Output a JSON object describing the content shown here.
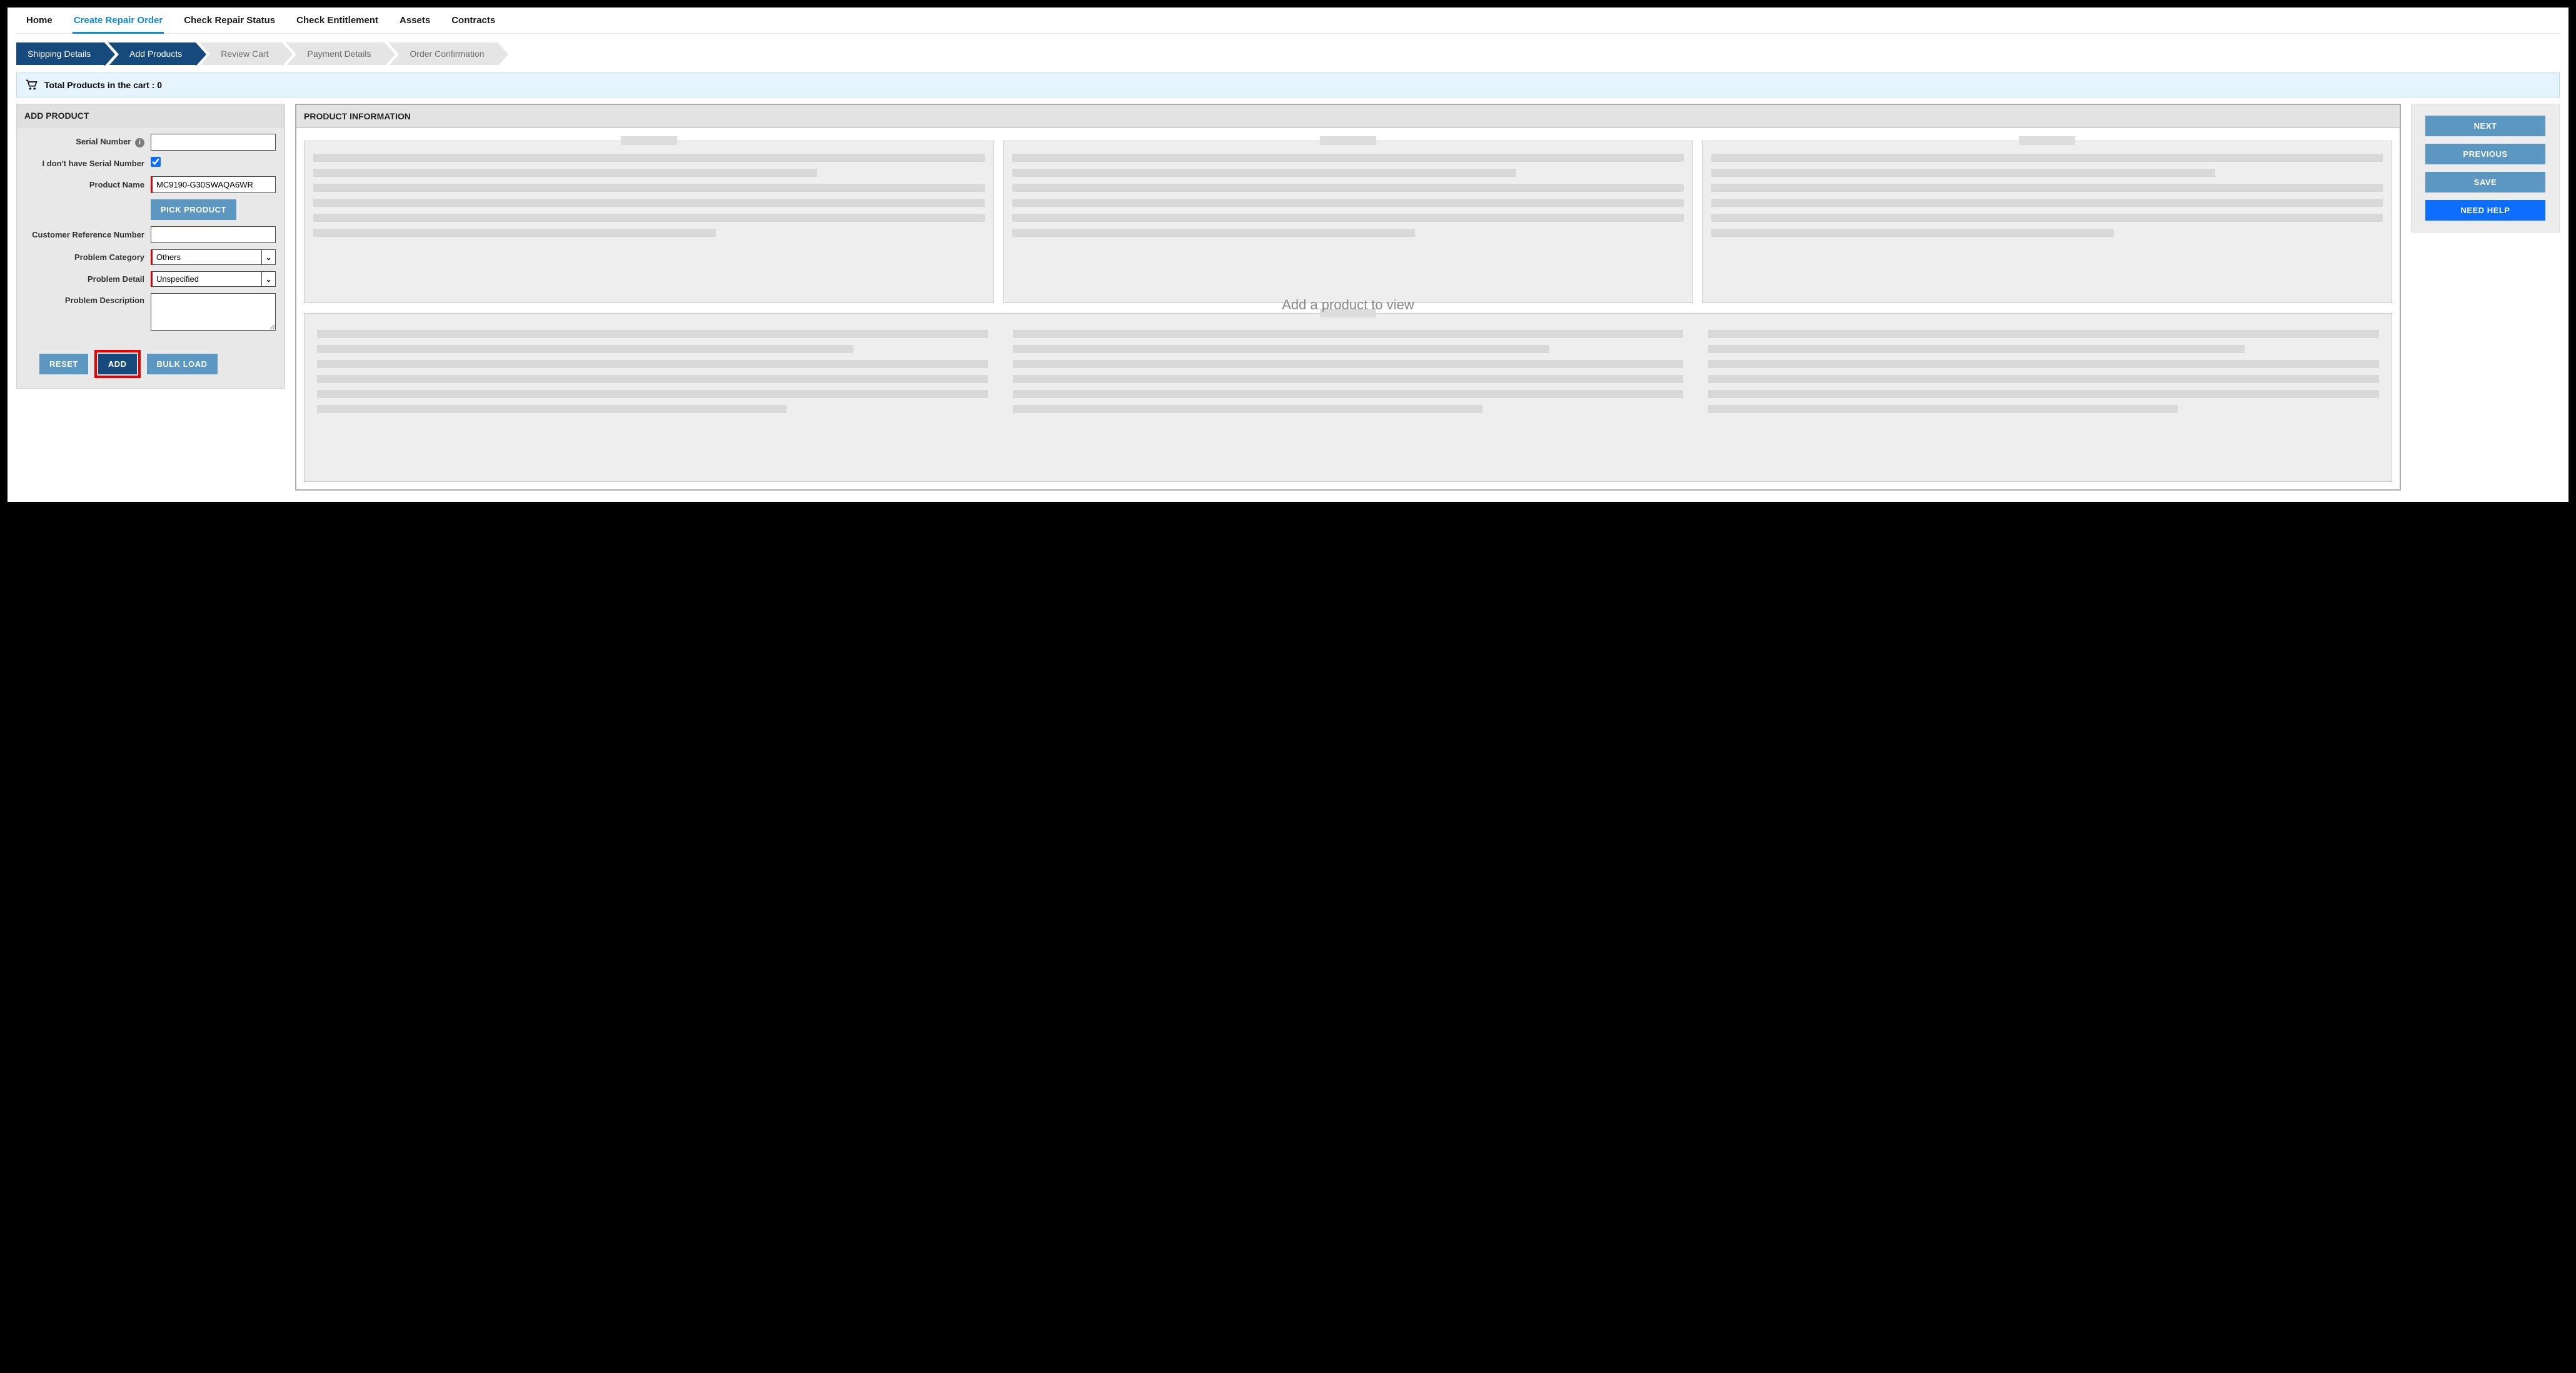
{
  "nav": {
    "items": [
      "Home",
      "Create Repair Order",
      "Check Repair Status",
      "Check Entitlement",
      "Assets",
      "Contracts"
    ],
    "active_index": 1
  },
  "steps": {
    "items": [
      "Shipping Details",
      "Add Products",
      "Review Cart",
      "Payment Details",
      "Order Confirmation"
    ],
    "done_through_index": 1
  },
  "cart": {
    "label": "Total Products in the cart : 0"
  },
  "add_product": {
    "header": "ADD PRODUCT",
    "serial_label": "Serial Number",
    "serial_value": "",
    "no_serial_label": "I don't have Serial Number",
    "no_serial_checked": true,
    "product_name_label": "Product Name",
    "product_name_value": "MC9190-G30SWAQA6WR",
    "pick_product_label": "PICK PRODUCT",
    "cust_ref_label": "Customer Reference Number",
    "cust_ref_value": "",
    "problem_cat_label": "Problem Category",
    "problem_cat_value": "Others",
    "problem_detail_label": "Problem Detail",
    "problem_detail_value": "Unspecified",
    "problem_desc_label": "Problem Description",
    "problem_desc_value": "",
    "reset_label": "RESET",
    "add_label": "ADD",
    "bulk_label": "BULK LOAD"
  },
  "product_info": {
    "header": "PRODUCT INFORMATION",
    "empty_text": "Add a product to view"
  },
  "actions": {
    "next": "NEXT",
    "prev": "PREVIOUS",
    "save": "SAVE",
    "help": "NEED HELP"
  }
}
